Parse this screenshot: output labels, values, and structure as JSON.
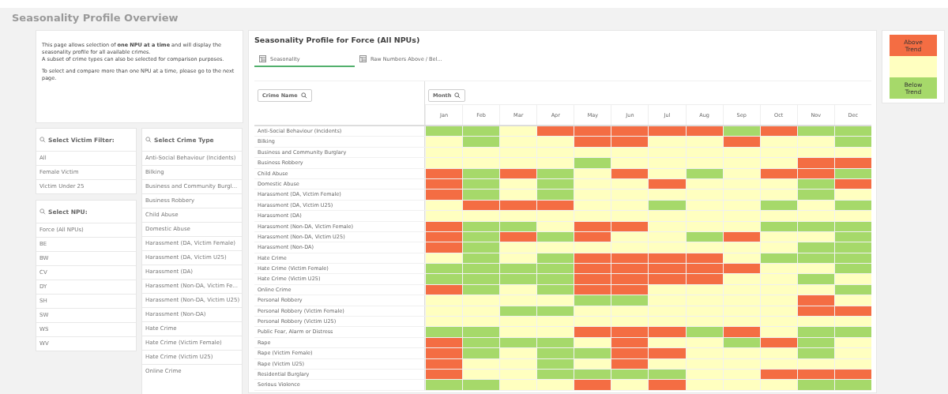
{
  "page_title": "Seasonality Profile Overview",
  "info": {
    "paragraphs": [
      "This page allows selection of **one NPU at a time** and will display the seasonality profile for all available crimes.\nA subset of crime types can also be selected for comparison purposes.",
      "To select and compare more than one NPU at a time, please go to the next page."
    ]
  },
  "victim_filter": {
    "title": "Select Victim Filter:",
    "items": [
      "All",
      "Female Victim",
      "Victim Under 25"
    ]
  },
  "npu_filter": {
    "title": "Select NPU:",
    "items": [
      "Force (All NPUs)",
      "BE",
      "BW",
      "CV",
      "DY",
      "SH",
      "SW",
      "WS",
      "WV"
    ]
  },
  "crime_filter": {
    "title": "Select Crime Type",
    "items": [
      "Anti-Social Behaviour (Incidents)",
      "Bilking",
      "Business and Community Burgl...",
      "Business Robbery",
      "Child Abuse",
      "Domestic Abuse",
      "Harassment (DA, Victim Female)",
      "Harassment (DA, Victim U25)",
      "Harassment (DA)",
      "Harassment (Non-DA, Victim Fe...",
      "Harassment (Non-DA, Victim U25)",
      "Harassment (Non-DA)",
      "Hate Crime",
      "Hate Crime (Victim Female)",
      "Hate Crime (Victim U25)",
      "Online Crime"
    ]
  },
  "main": {
    "title": "Seasonality Profile for Force (All NPUs)",
    "tabs": [
      {
        "label": "Seasonality",
        "selected": true
      },
      {
        "label": "Raw Numbers Above / Bel...",
        "selected": false
      }
    ],
    "grid": {
      "row_filter": "Crime Name",
      "column_filter": "Month",
      "months": [
        "Jan",
        "Feb",
        "Mar",
        "Apr",
        "May",
        "Jun",
        "Jul",
        "Aug",
        "Sep",
        "Oct",
        "Nov",
        "Dec"
      ],
      "rows": [
        {
          "name": "Anti-Social Behaviour (Incidents)",
          "cells": [
            {
              "color": "#a6d96a"
            },
            {
              "color": "#a6d96a"
            },
            {
              "color": "#ffffc0"
            },
            {
              "color": "#f46d43"
            },
            {
              "color": "#f46d43"
            },
            {
              "color": "#f46d43"
            },
            {
              "color": "#f46d43"
            },
            {
              "color": "#f46d43"
            },
            {
              "color": "#a6d96a"
            },
            {
              "color": "#f46d43"
            },
            {
              "color": "#a6d96a"
            },
            {
              "color": "#a6d96a"
            }
          ]
        },
        {
          "name": "Bilking",
          "cells": [
            {
              "color": "#ffffc0"
            },
            {
              "color": "#a6d96a"
            },
            {
              "color": "#ffffc0"
            },
            {
              "color": "#ffffc0"
            },
            {
              "color": "#f46d43"
            },
            {
              "color": "#f46d43"
            },
            {
              "color": "#ffffc0"
            },
            {
              "color": "#ffffc0"
            },
            {
              "color": "#f46d43"
            },
            {
              "color": "#ffffc0"
            },
            {
              "color": "#ffffc0"
            },
            {
              "color": "#a6d96a"
            }
          ]
        },
        {
          "name": "Business and Community Burglary",
          "cells": [
            {
              "color": "#ffffc0"
            },
            {
              "color": "#ffffc0"
            },
            {
              "color": "#ffffc0"
            },
            {
              "color": "#ffffc0"
            },
            {
              "color": "#ffffc0"
            },
            {
              "color": "#ffffc0"
            },
            {
              "color": "#ffffc0"
            },
            {
              "color": "#ffffc0"
            },
            {
              "color": "#ffffc0"
            },
            {
              "color": "#ffffc0"
            },
            {
              "color": "#ffffc0"
            },
            {
              "color": "#ffffc0"
            }
          ]
        },
        {
          "name": "Business Robbery",
          "cells": [
            {
              "color": "#ffffc0"
            },
            {
              "color": "#ffffc0"
            },
            {
              "color": "#ffffc0"
            },
            {
              "color": "#ffffc0"
            },
            {
              "color": "#a6d96a"
            },
            {
              "color": "#ffffc0"
            },
            {
              "color": "#ffffc0"
            },
            {
              "color": "#ffffc0"
            },
            {
              "color": "#ffffc0"
            },
            {
              "color": "#ffffc0"
            },
            {
              "color": "#f46d43"
            },
            {
              "color": "#f46d43"
            }
          ]
        },
        {
          "name": "Child Abuse",
          "cells": [
            {
              "color": "#f46d43"
            },
            {
              "color": "#a6d96a"
            },
            {
              "color": "#f46d43"
            },
            {
              "color": "#a6d96a"
            },
            {
              "color": "#ffffc0"
            },
            {
              "color": "#f46d43"
            },
            {
              "color": "#ffffc0"
            },
            {
              "color": "#a6d96a"
            },
            {
              "color": "#ffffc0"
            },
            {
              "color": "#f46d43"
            },
            {
              "color": "#f46d43"
            },
            {
              "color": "#a6d96a"
            }
          ]
        },
        {
          "name": "Domestic Abuse",
          "cells": [
            {
              "color": "#f46d43"
            },
            {
              "color": "#a6d96a"
            },
            {
              "color": "#ffffc0"
            },
            {
              "color": "#a6d96a"
            },
            {
              "color": "#ffffc0"
            },
            {
              "color": "#ffffc0"
            },
            {
              "color": "#f46d43"
            },
            {
              "color": "#ffffc0"
            },
            {
              "color": "#ffffc0"
            },
            {
              "color": "#ffffc0"
            },
            {
              "color": "#a6d96a"
            },
            {
              "color": "#f46d43"
            }
          ]
        },
        {
          "name": "Harassment (DA, Victim Female)",
          "cells": [
            {
              "color": "#f46d43"
            },
            {
              "color": "#a6d96a"
            },
            {
              "color": "#ffffc0"
            },
            {
              "color": "#a6d96a"
            },
            {
              "color": "#ffffc0"
            },
            {
              "color": "#ffffc0"
            },
            {
              "color": "#ffffc0"
            },
            {
              "color": "#ffffc0"
            },
            {
              "color": "#ffffc0"
            },
            {
              "color": "#ffffc0"
            },
            {
              "color": "#a6d96a"
            },
            {
              "color": "#ffffc0"
            }
          ]
        },
        {
          "name": "Harassment (DA, Victim U25)",
          "cells": [
            {
              "color": "#ffffc0"
            },
            {
              "color": "#f46d43"
            },
            {
              "color": "#f46d43"
            },
            {
              "color": "#f46d43"
            },
            {
              "color": "#ffffc0"
            },
            {
              "color": "#ffffc0"
            },
            {
              "color": "#a6d96a"
            },
            {
              "color": "#ffffc0"
            },
            {
              "color": "#ffffc0"
            },
            {
              "color": "#a6d96a"
            },
            {
              "color": "#ffffc0"
            },
            {
              "color": "#a6d96a"
            }
          ]
        },
        {
          "name": "Harassment (DA)",
          "cells": [
            {
              "color": "#ffffc0"
            },
            {
              "color": "#ffffc0"
            },
            {
              "color": "#ffffc0"
            },
            {
              "color": "#ffffc0"
            },
            {
              "color": "#ffffc0"
            },
            {
              "color": "#ffffc0"
            },
            {
              "color": "#ffffc0"
            },
            {
              "color": "#ffffc0"
            },
            {
              "color": "#ffffc0"
            },
            {
              "color": "#ffffc0"
            },
            {
              "color": "#ffffc0"
            },
            {
              "color": "#ffffc0"
            }
          ]
        },
        {
          "name": "Harassment (Non-DA, Victim Female)",
          "cells": [
            {
              "color": "#f46d43"
            },
            {
              "color": "#a6d96a"
            },
            {
              "color": "#a6d96a"
            },
            {
              "color": "#ffffc0"
            },
            {
              "color": "#f46d43"
            },
            {
              "color": "#f46d43"
            },
            {
              "color": "#ffffc0"
            },
            {
              "color": "#ffffc0"
            },
            {
              "color": "#ffffc0"
            },
            {
              "color": "#a6d96a"
            },
            {
              "color": "#a6d96a"
            },
            {
              "color": "#a6d96a"
            }
          ]
        },
        {
          "name": "Harassment (Non-DA, Victim U25)",
          "cells": [
            {
              "color": "#f46d43"
            },
            {
              "color": "#a6d96a"
            },
            {
              "color": "#f46d43"
            },
            {
              "color": "#a6d96a"
            },
            {
              "color": "#f46d43"
            },
            {
              "color": "#ffffc0"
            },
            {
              "color": "#ffffc0"
            },
            {
              "color": "#a6d96a"
            },
            {
              "color": "#f46d43"
            },
            {
              "color": "#ffffc0"
            },
            {
              "color": "#ffffc0"
            },
            {
              "color": "#a6d96a"
            }
          ]
        },
        {
          "name": "Harassment (Non-DA)",
          "cells": [
            {
              "color": "#f46d43"
            },
            {
              "color": "#a6d96a"
            },
            {
              "color": "#ffffc0"
            },
            {
              "color": "#ffffc0"
            },
            {
              "color": "#ffffc0"
            },
            {
              "color": "#ffffc0"
            },
            {
              "color": "#ffffc0"
            },
            {
              "color": "#ffffc0"
            },
            {
              "color": "#ffffc0"
            },
            {
              "color": "#ffffc0"
            },
            {
              "color": "#a6d96a"
            },
            {
              "color": "#a6d96a"
            }
          ]
        },
        {
          "name": "Hate Crime",
          "cells": [
            {
              "color": "#ffffc0"
            },
            {
              "color": "#a6d96a"
            },
            {
              "color": "#ffffc0"
            },
            {
              "color": "#a6d96a"
            },
            {
              "color": "#f46d43"
            },
            {
              "color": "#f46d43"
            },
            {
              "color": "#f46d43"
            },
            {
              "color": "#f46d43"
            },
            {
              "color": "#ffffc0"
            },
            {
              "color": "#a6d96a"
            },
            {
              "color": "#a6d96a"
            },
            {
              "color": "#a6d96a"
            }
          ]
        },
        {
          "name": "Hate Crime (Victim Female)",
          "cells": [
            {
              "color": "#a6d96a"
            },
            {
              "color": "#a6d96a"
            },
            {
              "color": "#a6d96a"
            },
            {
              "color": "#a6d96a"
            },
            {
              "color": "#f46d43"
            },
            {
              "color": "#f46d43"
            },
            {
              "color": "#f46d43"
            },
            {
              "color": "#f46d43"
            },
            {
              "color": "#f46d43"
            },
            {
              "color": "#ffffc0"
            },
            {
              "color": "#ffffc0"
            },
            {
              "color": "#a6d96a"
            }
          ]
        },
        {
          "name": "Hate Crime (Victim U25)",
          "cells": [
            {
              "color": "#a6d96a"
            },
            {
              "color": "#a6d96a"
            },
            {
              "color": "#a6d96a"
            },
            {
              "color": "#a6d96a"
            },
            {
              "color": "#f46d43"
            },
            {
              "color": "#f46d43"
            },
            {
              "color": "#f46d43"
            },
            {
              "color": "#f46d43"
            },
            {
              "color": "#ffffc0"
            },
            {
              "color": "#ffffc0"
            },
            {
              "color": "#a6d96a"
            },
            {
              "color": "#ffffc0"
            }
          ]
        },
        {
          "name": "Online Crime",
          "cells": [
            {
              "color": "#f46d43"
            },
            {
              "color": "#a6d96a"
            },
            {
              "color": "#ffffc0"
            },
            {
              "color": "#a6d96a"
            },
            {
              "color": "#f46d43"
            },
            {
              "color": "#f46d43"
            },
            {
              "color": "#ffffc0"
            },
            {
              "color": "#ffffc0"
            },
            {
              "color": "#ffffc0"
            },
            {
              "color": "#ffffc0"
            },
            {
              "color": "#ffffc0"
            },
            {
              "color": "#a6d96a"
            }
          ]
        },
        {
          "name": "Personal Robbery",
          "cells": [
            {
              "color": "#ffffc0"
            },
            {
              "color": "#ffffc0"
            },
            {
              "color": "#ffffc0"
            },
            {
              "color": "#ffffc0"
            },
            {
              "color": "#a6d96a"
            },
            {
              "color": "#a6d96a"
            },
            {
              "color": "#ffffc0"
            },
            {
              "color": "#ffffc0"
            },
            {
              "color": "#ffffc0"
            },
            {
              "color": "#ffffc0"
            },
            {
              "color": "#f46d43"
            },
            {
              "color": "#ffffc0"
            }
          ]
        },
        {
          "name": "Personal Robbery (Victim Female)",
          "cells": [
            {
              "color": "#ffffc0"
            },
            {
              "color": "#ffffc0"
            },
            {
              "color": "#a6d96a"
            },
            {
              "color": "#a6d96a"
            },
            {
              "color": "#ffffc0"
            },
            {
              "color": "#ffffc0"
            },
            {
              "color": "#ffffc0"
            },
            {
              "color": "#ffffc0"
            },
            {
              "color": "#ffffc0"
            },
            {
              "color": "#ffffc0"
            },
            {
              "color": "#f46d43"
            },
            {
              "color": "#f46d43"
            }
          ]
        },
        {
          "name": "Personal Robbery (Victim U25)",
          "cells": [
            {
              "color": "#ffffc0"
            },
            {
              "color": "#ffffc0"
            },
            {
              "color": "#ffffc0"
            },
            {
              "color": "#ffffc0"
            },
            {
              "color": "#ffffc0"
            },
            {
              "color": "#ffffc0"
            },
            {
              "color": "#ffffc0"
            },
            {
              "color": "#ffffc0"
            },
            {
              "color": "#ffffc0"
            },
            {
              "color": "#ffffc0"
            },
            {
              "color": "#ffffc0"
            },
            {
              "color": "#ffffc0"
            }
          ]
        },
        {
          "name": "Public Fear, Alarm or Distress",
          "cells": [
            {
              "color": "#a6d96a"
            },
            {
              "color": "#a6d96a"
            },
            {
              "color": "#ffffc0"
            },
            {
              "color": "#ffffc0"
            },
            {
              "color": "#f46d43"
            },
            {
              "color": "#f46d43"
            },
            {
              "color": "#f46d43"
            },
            {
              "color": "#a6d96a"
            },
            {
              "color": "#f46d43"
            },
            {
              "color": "#ffffc0"
            },
            {
              "color": "#a6d96a"
            },
            {
              "color": "#a6d96a"
            }
          ]
        },
        {
          "name": "Rape",
          "cells": [
            {
              "color": "#f46d43"
            },
            {
              "color": "#a6d96a"
            },
            {
              "color": "#a6d96a"
            },
            {
              "color": "#a6d96a"
            },
            {
              "color": "#ffffc0"
            },
            {
              "color": "#f46d43"
            },
            {
              "color": "#ffffc0"
            },
            {
              "color": "#ffffc0"
            },
            {
              "color": "#a6d96a"
            },
            {
              "color": "#f46d43"
            },
            {
              "color": "#a6d96a"
            },
            {
              "color": "#ffffc0"
            }
          ]
        },
        {
          "name": "Rape (Victim Female)",
          "cells": [
            {
              "color": "#f46d43"
            },
            {
              "color": "#a6d96a"
            },
            {
              "color": "#ffffc0"
            },
            {
              "color": "#a6d96a"
            },
            {
              "color": "#a6d96a"
            },
            {
              "color": "#f46d43"
            },
            {
              "color": "#f46d43"
            },
            {
              "color": "#ffffc0"
            },
            {
              "color": "#ffffc0"
            },
            {
              "color": "#ffffc0"
            },
            {
              "color": "#a6d96a"
            },
            {
              "color": "#ffffc0"
            }
          ]
        },
        {
          "name": "Rape (Victim U25)",
          "cells": [
            {
              "color": "#f46d43"
            },
            {
              "color": "#ffffc0"
            },
            {
              "color": "#ffffc0"
            },
            {
              "color": "#a6d96a"
            },
            {
              "color": "#ffffc0"
            },
            {
              "color": "#f46d43"
            },
            {
              "color": "#ffffc0"
            },
            {
              "color": "#ffffc0"
            },
            {
              "color": "#ffffc0"
            },
            {
              "color": "#ffffc0"
            },
            {
              "color": "#ffffc0"
            },
            {
              "color": "#ffffc0"
            }
          ]
        },
        {
          "name": "Residential Burglary",
          "cells": [
            {
              "color": "#f46d43"
            },
            {
              "color": "#ffffc0"
            },
            {
              "color": "#ffffc0"
            },
            {
              "color": "#a6d96a"
            },
            {
              "color": "#a6d96a"
            },
            {
              "color": "#a6d96a"
            },
            {
              "color": "#a6d96a"
            },
            {
              "color": "#ffffc0"
            },
            {
              "color": "#ffffc0"
            },
            {
              "color": "#f46d43"
            },
            {
              "color": "#f46d43"
            },
            {
              "color": "#f46d43"
            }
          ]
        },
        {
          "name": "Serious Violence",
          "cells": [
            {
              "color": "#a6d96a"
            },
            {
              "color": "#a6d96a"
            },
            {
              "color": "#ffffc0"
            },
            {
              "color": "#ffffc0"
            },
            {
              "color": "#f46d43"
            },
            {
              "color": "#ffffc0"
            },
            {
              "color": "#f46d43"
            },
            {
              "color": "#ffffc0"
            },
            {
              "color": "#ffffc0"
            },
            {
              "color": "#ffffc0"
            },
            {
              "color": "#a6d96a"
            },
            {
              "color": "#a6d96a"
            }
          ]
        }
      ]
    }
  },
  "legend": [
    {
      "color": "#f46d43",
      "label": "Above Trend"
    },
    {
      "color": "#ffffc0"
    },
    {
      "color": "#a6d96a",
      "label": "Below Trend"
    }
  ]
}
